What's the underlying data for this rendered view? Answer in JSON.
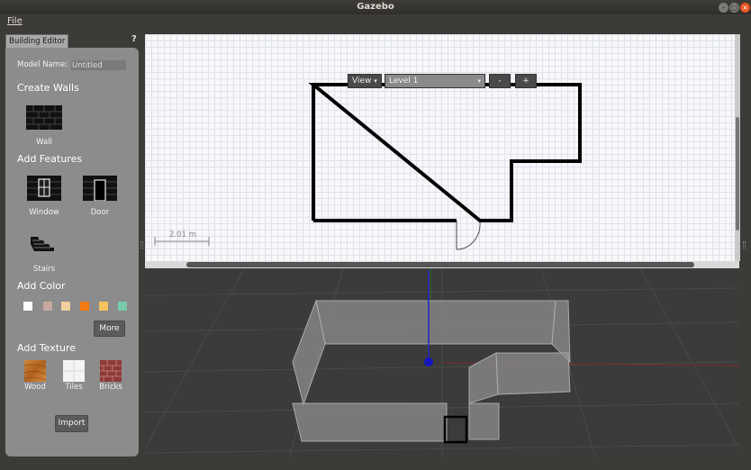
{
  "window": {
    "title": "Gazebo"
  },
  "menu": {
    "file": "File"
  },
  "left_panel": {
    "tab": "Building Editor",
    "help": "?",
    "model_name_label": "Model Name:",
    "model_name_value": "Untitled",
    "create_walls": "Create Walls",
    "wall": "Wall",
    "add_features": "Add Features",
    "window": "Window",
    "door": "Door",
    "stairs": "Stairs",
    "add_color": "Add Color",
    "colors": [
      "#ffffff",
      "#c6a9a0",
      "#f0cfa0",
      "#f57c12",
      "#f5c25c",
      "#77cba8"
    ],
    "more": "More",
    "add_texture": "Add Texture",
    "textures": {
      "wood": "Wood",
      "tiles": "Tiles",
      "bricks": "Bricks"
    },
    "import": "Import"
  },
  "editor_2d": {
    "view_button": "View",
    "level": "Level 1",
    "minus": "-",
    "plus": "+",
    "scale_label": "2.01 m"
  },
  "icons": [
    "wall-icon",
    "window-icon",
    "door-icon",
    "stairs-icon",
    "wood-texture-icon",
    "tiles-texture-icon",
    "bricks-texture-icon"
  ]
}
